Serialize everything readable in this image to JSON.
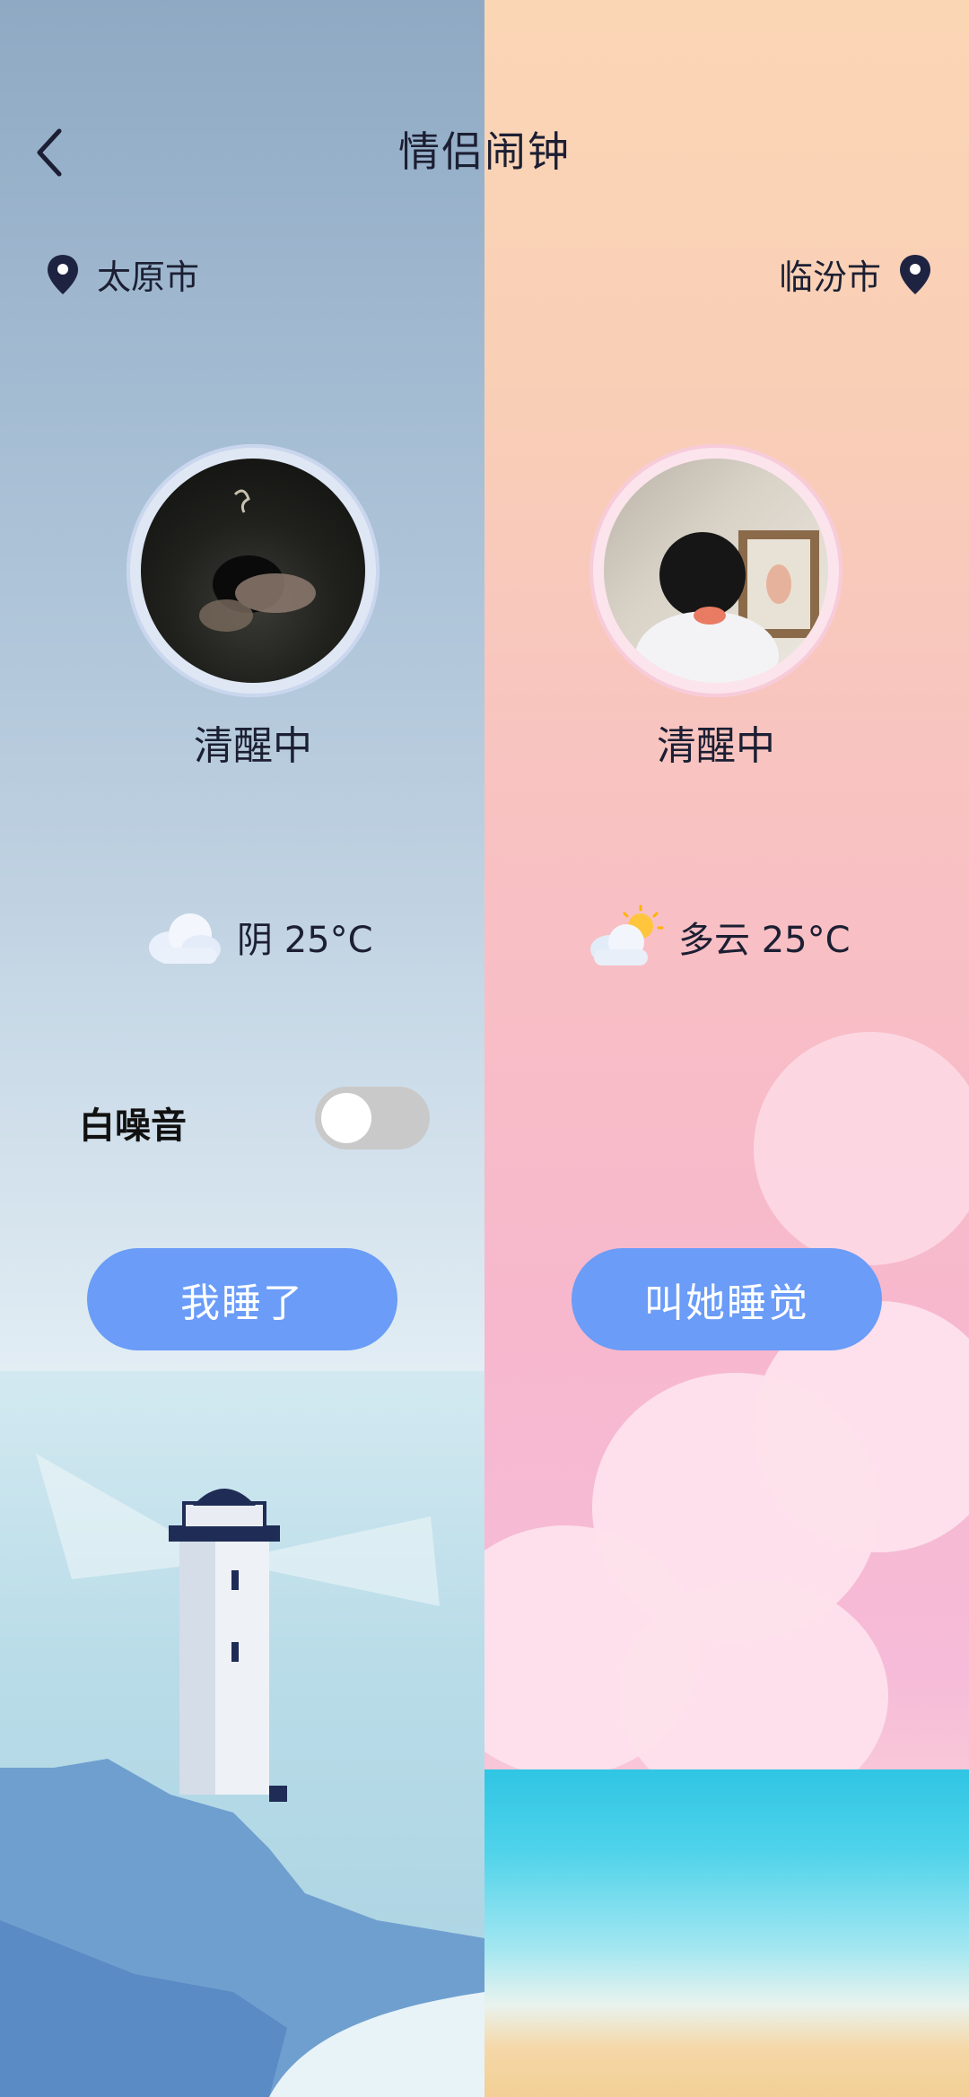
{
  "header": {
    "title": "情侣闹钟",
    "back_icon": "chevron-left-icon"
  },
  "left": {
    "city": "太原市",
    "status": "清醒中",
    "weather": {
      "text": "阴 25°C",
      "icon": "cloud-icon"
    },
    "white_noise": {
      "label": "白噪音",
      "enabled": false
    },
    "button": "我睡了"
  },
  "right": {
    "city": "临汾市",
    "status": "清醒中",
    "weather": {
      "text": "多云 25°C",
      "icon": "partly-cloudy-icon"
    },
    "button": "叫她睡觉"
  },
  "colors": {
    "accent": "#6a9cf8",
    "text": "#1c1f33",
    "toggle_off": "#c9c9c9"
  }
}
